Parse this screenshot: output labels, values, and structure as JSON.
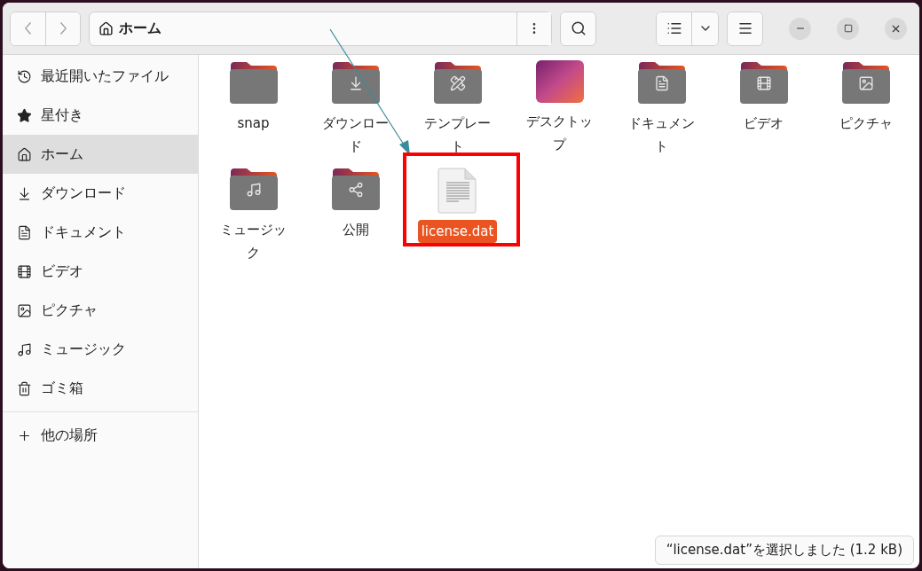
{
  "toolbar": {
    "path_label": "ホーム"
  },
  "sidebar": {
    "items": [
      {
        "label": "最近開いたファイル",
        "selected": false
      },
      {
        "label": "星付き",
        "selected": false
      },
      {
        "label": "ホーム",
        "selected": true
      },
      {
        "label": "ダウンロード",
        "selected": false
      },
      {
        "label": "ドキュメント",
        "selected": false
      },
      {
        "label": "ビデオ",
        "selected": false
      },
      {
        "label": "ピクチャ",
        "selected": false
      },
      {
        "label": "ミュージック",
        "selected": false
      },
      {
        "label": "ゴミ箱",
        "selected": false
      }
    ],
    "other": {
      "label": "他の場所",
      "selected": false
    }
  },
  "files": [
    {
      "name": "snap",
      "kind": "folder",
      "selected": false
    },
    {
      "name": "ダウンロード",
      "kind": "folder",
      "selected": false
    },
    {
      "name": "テンプレート",
      "kind": "folder",
      "selected": false
    },
    {
      "name": "デスクトップ",
      "kind": "desktop",
      "selected": false
    },
    {
      "name": "ドキュメント",
      "kind": "folder",
      "selected": false
    },
    {
      "name": "ビデオ",
      "kind": "folder",
      "selected": false
    },
    {
      "name": "ピクチャ",
      "kind": "folder",
      "selected": false
    },
    {
      "name": "ミュージック",
      "kind": "folder",
      "selected": false
    },
    {
      "name": "公開",
      "kind": "folder",
      "selected": false
    },
    {
      "name": "license.dat",
      "kind": "file",
      "selected": true
    }
  ],
  "status_bar": "“license.dat”を選択しました (1.2 kB)"
}
